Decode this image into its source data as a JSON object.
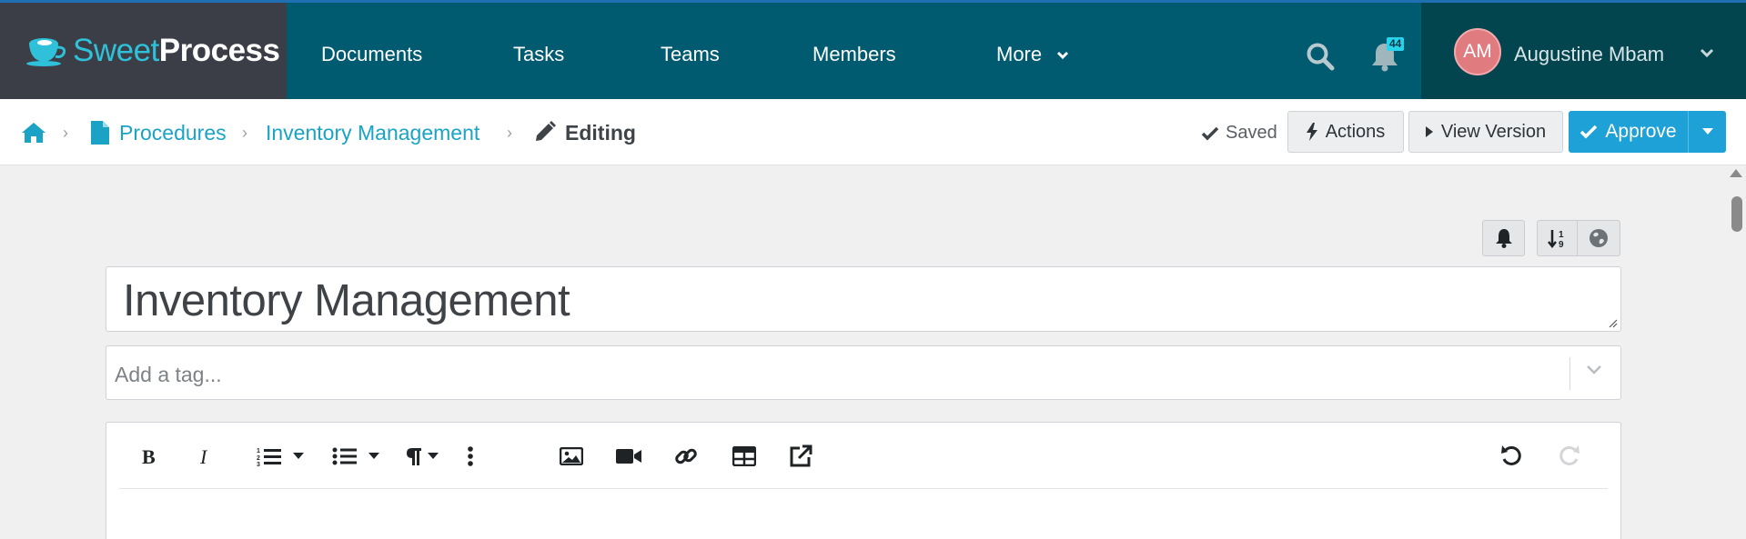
{
  "brand": {
    "part1": "Sweet",
    "part2": "Process",
    "colors": {
      "cyan": "#2fc1d9",
      "dark_bg": "#3b3e46"
    }
  },
  "nav": {
    "items": [
      {
        "label": "Documents"
      },
      {
        "label": "Tasks"
      },
      {
        "label": "Teams"
      },
      {
        "label": "Members"
      },
      {
        "label": "More"
      }
    ],
    "notification_count": "44",
    "user": {
      "initials": "AM",
      "name": "Augustine Mbam"
    },
    "colors": {
      "bar": "#015b70",
      "user_area": "#03454f",
      "badge": "#28d4ec"
    }
  },
  "breadcrumb": {
    "items": [
      "Procedures",
      "Inventory Management"
    ],
    "current": "Editing"
  },
  "header_actions": {
    "saved_label": "Saved",
    "actions_label": "Actions",
    "view_version_label": "View Version",
    "approve_label": "Approve",
    "approve_color": "#1ea1d6"
  },
  "editor": {
    "title": "Inventory Management",
    "tag_placeholder": "Add a tag...",
    "toolbar_icons": [
      "bold-icon",
      "italic-icon",
      "ordered-list-icon",
      "unordered-list-icon",
      "paragraph-icon",
      "more-vertical-icon",
      "image-icon",
      "video-icon",
      "link-icon",
      "table-icon",
      "external-link-icon",
      "undo-icon",
      "redo-icon"
    ]
  }
}
